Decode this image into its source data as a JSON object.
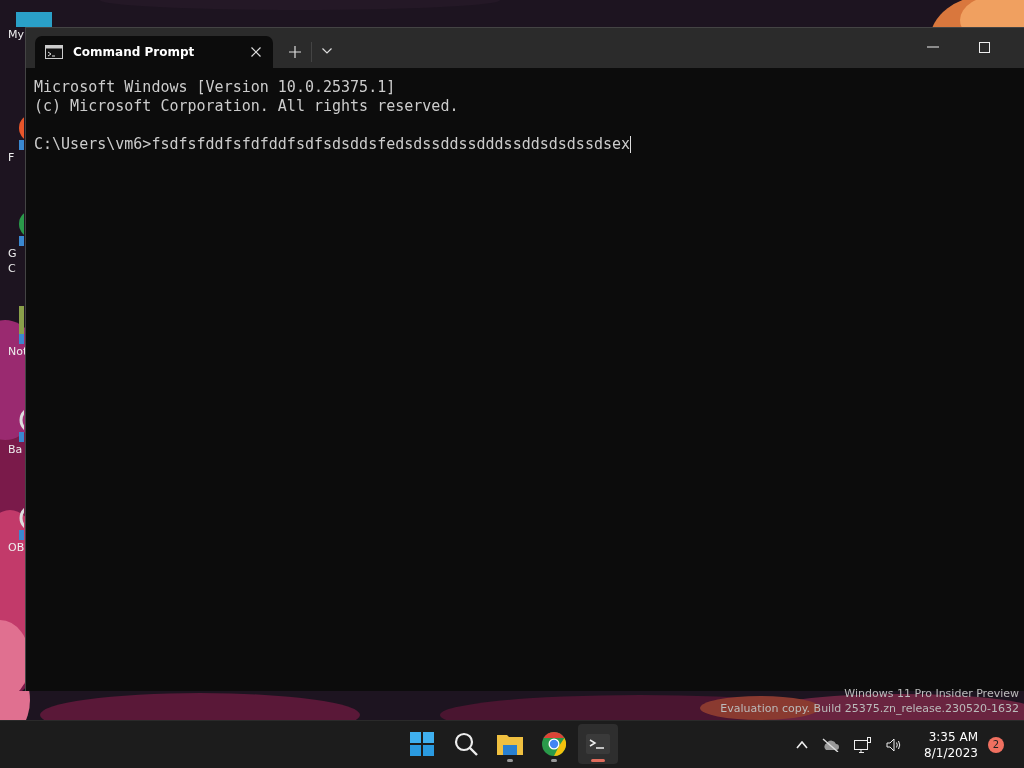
{
  "desktop": {
    "icons": [
      {
        "kind": "computer",
        "labels": [
          "My"
        ]
      },
      {
        "kind": "orange",
        "labels": [
          "F"
        ]
      },
      {
        "kind": "chrome",
        "labels": [
          "G",
          "C"
        ]
      },
      {
        "kind": "notepad",
        "labels": [
          "Not"
        ]
      },
      {
        "kind": "ring",
        "labels": [
          "Ba"
        ]
      },
      {
        "kind": "ring",
        "labels": [
          "OB"
        ]
      }
    ],
    "watermark": [
      "Windows 11 Pro Insider Preview",
      "Evaluation copy. Build 25375.zn_release.230520-1632"
    ]
  },
  "window": {
    "tabs": [
      {
        "title": "Command Prompt",
        "selected": true
      }
    ],
    "console": {
      "output_lines": [
        "Microsoft Windows [Version 10.0.25375.1]",
        "(c) Microsoft Corporation. All rights reserved."
      ],
      "prompt": "C:\\Users\\vm6>",
      "input": "fsdfsfddfsfdfddfsdfsdsddsfedsdssddssdddssddsdsdssdsex"
    }
  },
  "taskbar": {
    "apps": [
      {
        "kind": "start",
        "selected": false,
        "running": false
      },
      {
        "kind": "search",
        "selected": false,
        "running": false
      },
      {
        "kind": "explorer",
        "selected": false,
        "running": true
      },
      {
        "kind": "chrome",
        "selected": false,
        "running": true
      },
      {
        "kind": "terminal",
        "selected": true,
        "running": true
      }
    ],
    "time": "3:35 AM",
    "date": "8/1/2023",
    "notifications": "2"
  }
}
